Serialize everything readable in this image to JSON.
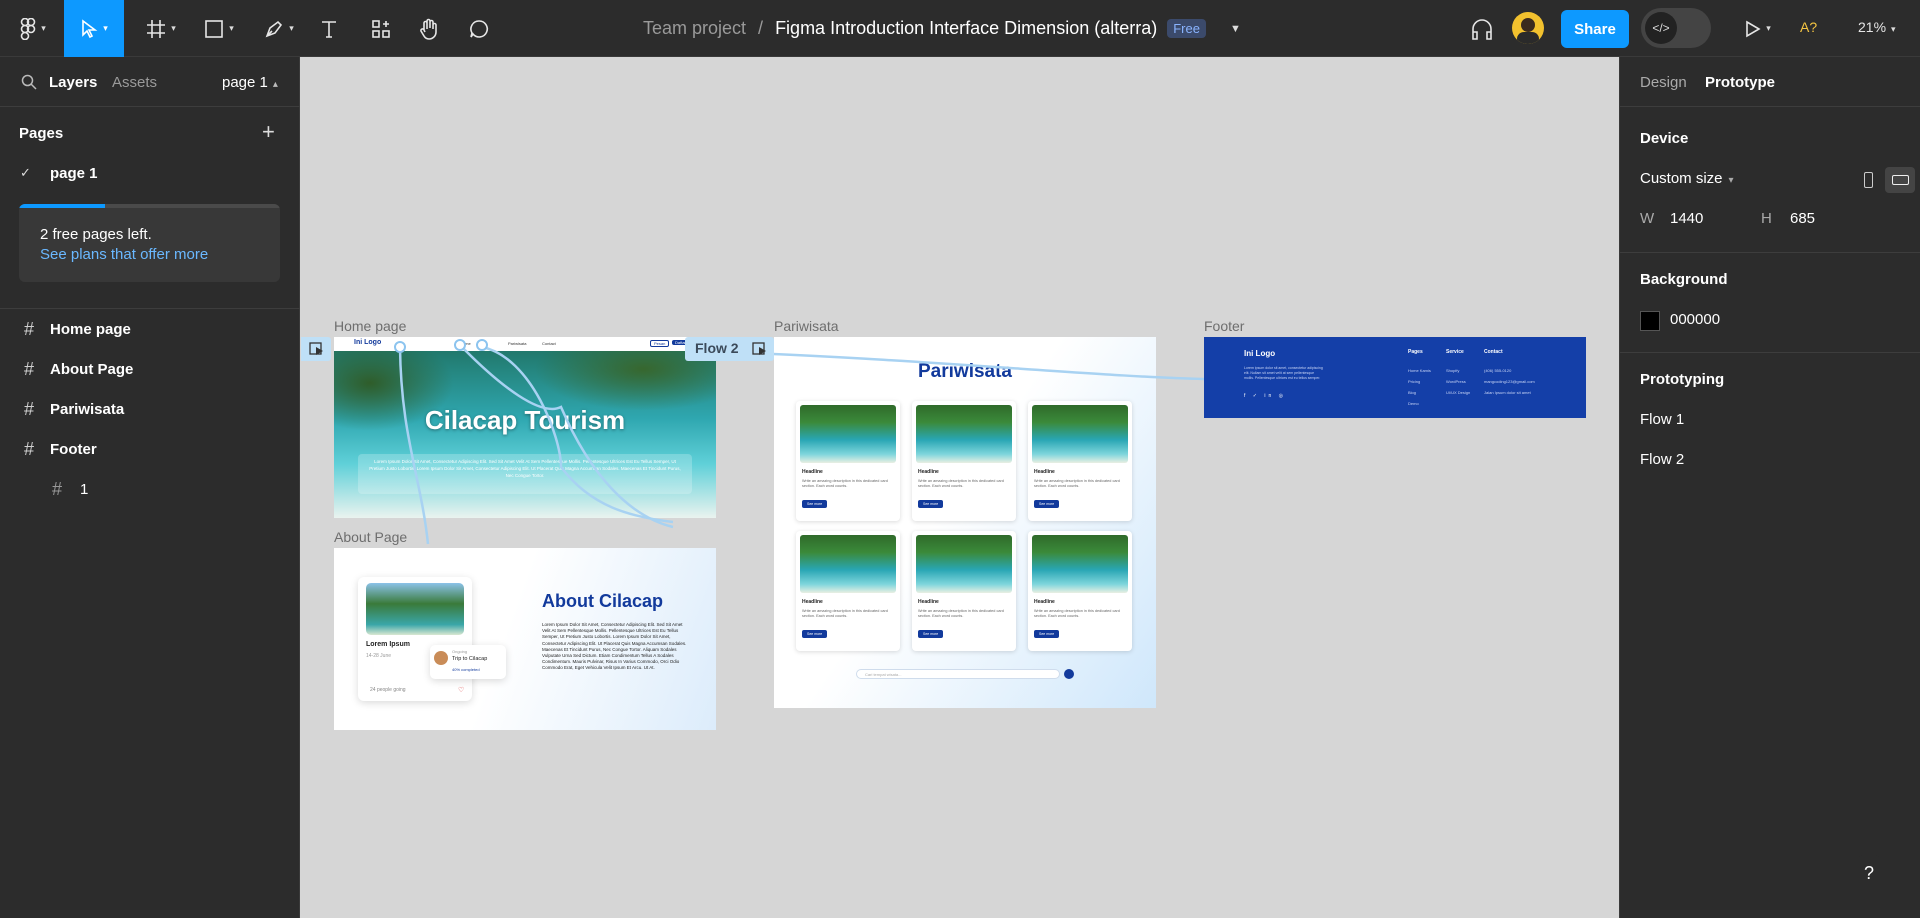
{
  "toolbar": {
    "main_menu_icon": "figma-logo-icon",
    "tools": [
      "move-tool",
      "frame-tool",
      "shape-tool",
      "pen-tool",
      "text-tool",
      "resources-tool",
      "hand-tool",
      "comment-tool"
    ],
    "breadcrumb_team": "Team project",
    "breadcrumb_sep": "/",
    "file_name": "Figma Introduction Interface Dimension (alterra)",
    "plan_badge": "Free",
    "share_label": "Share",
    "font_warning": "A?",
    "zoom": "21%",
    "accent": "#0d99ff"
  },
  "left_panel": {
    "tab_layers": "Layers",
    "tab_assets": "Assets",
    "current_page": "page 1",
    "pages_heading": "Pages",
    "pages": [
      "page 1"
    ],
    "notice_text": "2 free pages left.",
    "notice_link": "See plans that offer more",
    "layers": [
      {
        "label": "Home page",
        "indent": false
      },
      {
        "label": "About Page",
        "indent": false
      },
      {
        "label": "Pariwisata",
        "indent": false
      },
      {
        "label": "Footer",
        "indent": false
      },
      {
        "label": "1",
        "indent": true
      }
    ]
  },
  "right_panel": {
    "tab_design": "Design",
    "tab_prototype": "Prototype",
    "device_heading": "Device",
    "device_value": "Custom size",
    "w_label": "W",
    "w_value": "1440",
    "h_label": "H",
    "h_value": "685",
    "background_heading": "Background",
    "background_value": "000000",
    "background_color": "#000000",
    "prototyping_heading": "Prototyping",
    "flows": [
      "Flow 1",
      "Flow 2"
    ]
  },
  "canvas": {
    "labels": {
      "home": "Home page",
      "about": "About Page",
      "pariwisata": "Pariwisata",
      "footer": "Footer"
    },
    "flow_tag": "Flow 2",
    "home": {
      "logo": "Ini Logo",
      "nav": [
        "Home",
        "Pariwisata",
        "Contact",
        "Pesan",
        "Daftar"
      ],
      "hero_title": "Cilacap Tourism",
      "hero_body": "Lorem Ipsum Dolor Sit Amet, Consectetur Adipiscing Elit. Sed Sit Amet Velit At Sem Pellentesque Mollis. Pellentesque Ultrices Est Eu Tellus Semper, Ut Pretium Justo Lobortis. Lorem Ipsum Dolor Sit Amet, Consectetur Adipiscing Elit. Ut Placerat Quis Magna Accumsan Sodales. Maecenas Et Tincidunt Purus, Nec Congue Tortor."
    },
    "about": {
      "title": "About Cilacap",
      "card_title": "Lorem Ipsum",
      "card_date": "14-28 June",
      "card_people": "24 people going",
      "mini_label": "Ongoing",
      "mini_title": "Trip to Cilacap",
      "mini_progress": "40% completed",
      "body": "Lorem Ipsum Dolor Sit Amet, Consectetur Adipiscing Elit. Sed Sit Amet Velit At Sem Pellentesque Mollis. Pellentesque Ultrices Est Eu Tellus Semper, Ut Pretium Justo Lobortis. Lorem Ipsum Dolor Sit Amet, Consectetur Adipiscing Elit. Ut Placerat Quis Magna Accumsan Sodales. Maecenas Et Tincidunt Purus, Nec Congue Tortor. Aliquam Sodales Vulputate Urna Sed Dictum. Etiam Condimentum Tellus A Sodales Condimentum. Mauris Pulvinar, Risus In Varius Commodo, Orci Odio Commodo Erat, Eget Vehicula Velit Ipsum Et Arcu. Ut At."
    },
    "pariwisata": {
      "title": "Pariwisata",
      "cards": [
        {
          "head": "Headline",
          "text": "Write an amazing description in this dedicated card section. Each word counts.",
          "btn": "See more"
        },
        {
          "head": "Headline",
          "text": "Write an amazing description in this dedicated card section. Each word counts.",
          "btn": "See more"
        },
        {
          "head": "Headline",
          "text": "Write an amazing description in this dedicated card section. Each word counts.",
          "btn": "See more"
        },
        {
          "head": "Headline",
          "text": "Write an amazing description in this dedicated card section. Each word counts.",
          "btn": "See more"
        },
        {
          "head": "Headline",
          "text": "Write an amazing description in this dedicated card section. Each word counts.",
          "btn": "See more"
        },
        {
          "head": "Headline",
          "text": "Write an amazing description in this dedicated card section. Each word counts.",
          "btn": "See more"
        }
      ],
      "search_placeholder": "Cari tempat wisata..."
    },
    "footer": {
      "logo": "Ini Logo",
      "desc": "Lorem ipsum dolor sit amet, consectetur adipiscing elit. Nullam sit amet velit at sem pellentesque mollis. Pellentesque ultrices est eu tellus semper.",
      "col_pages": "Pages",
      "pages": [
        "Home Kamis",
        "Pricing",
        "Blog",
        "Demo"
      ],
      "col_service": "Service",
      "services": [
        "Shopify",
        "WordPress",
        "UI/UX Design"
      ],
      "col_contact": "Contact",
      "contacts": [
        "(406) 555-0120",
        "mangcoding123@gmail.com",
        "Jalan Ipsum dolor sit amet"
      ]
    }
  }
}
